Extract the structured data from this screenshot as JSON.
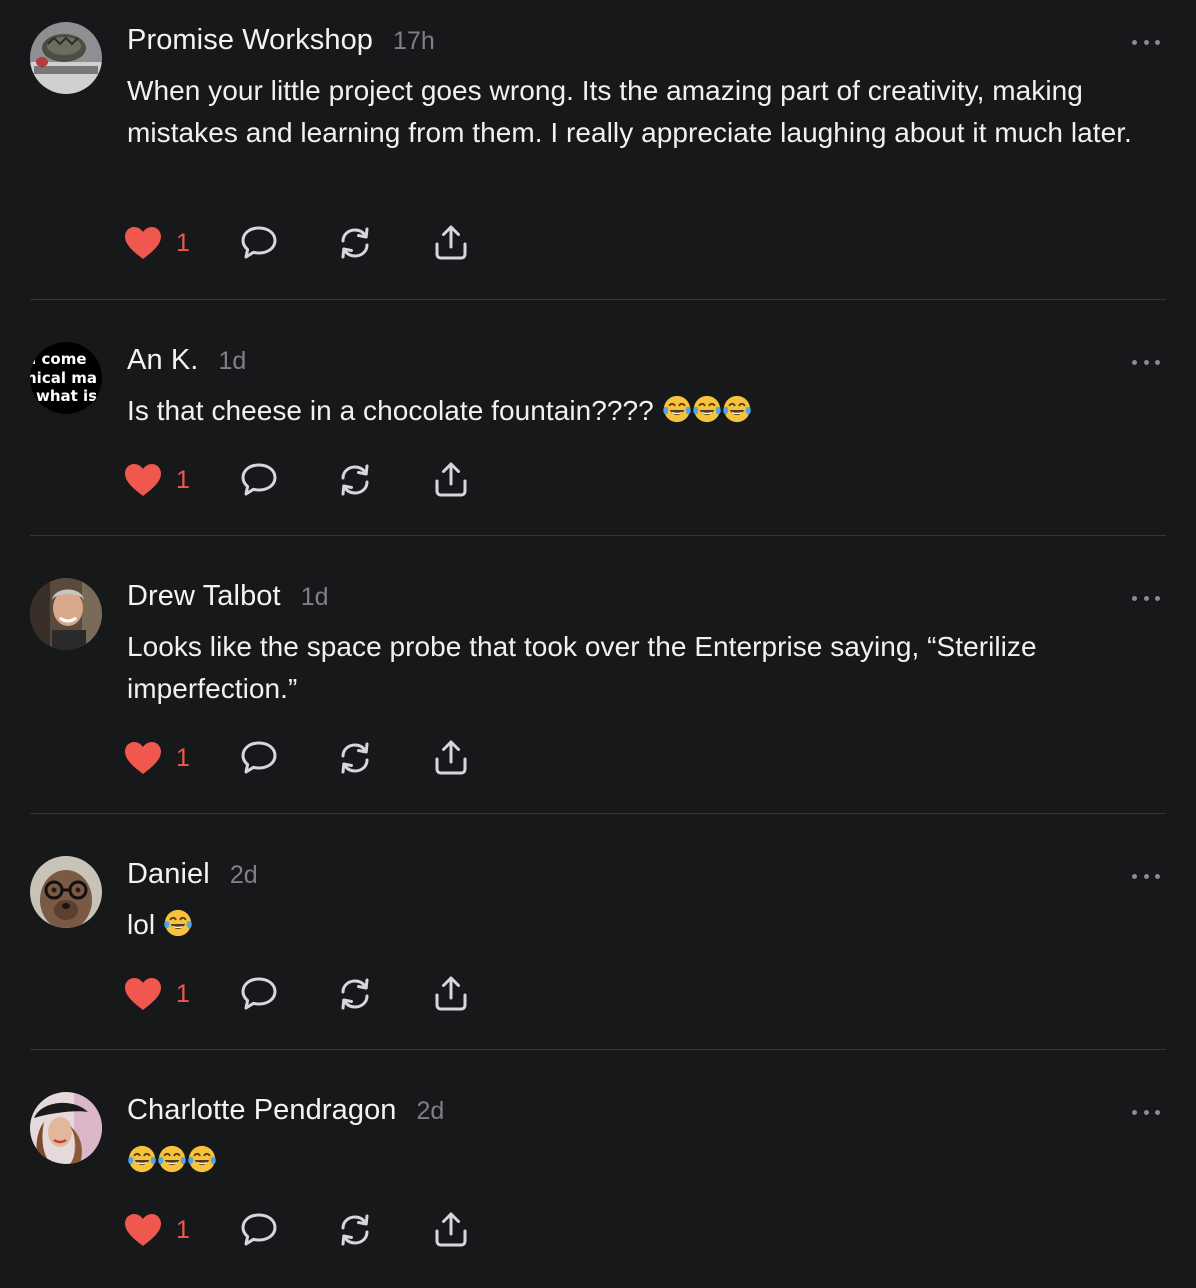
{
  "colors": {
    "background": "#17181a",
    "like": "#f0574f",
    "muted": "#7f8086",
    "divider": "#34353a"
  },
  "icons": {
    "like": "heart-icon",
    "reply": "speech-bubble-icon",
    "repost": "repost-arrows-icon",
    "share": "share-upload-icon",
    "more": "ellipsis-icon"
  },
  "comments": [
    {
      "author": "Promise Workshop",
      "time": "17h",
      "text": "When your little project goes wrong. Its the amazing part of creativity, making mistakes and learning from them. I really appreciate laughing about it much later.",
      "emoji_count": 0,
      "likes": "1"
    },
    {
      "author": "An K.",
      "time": "1d",
      "text": "Is that cheese in a chocolate fountain???? ",
      "emoji_count": 3,
      "likes": "1",
      "avatar_text": [
        "ll come",
        "hical ma",
        "what is"
      ]
    },
    {
      "author": "Drew Talbot",
      "time": "1d",
      "text": "Looks like the space probe that took over the Enterprise saying, “Sterilize imperfection.”",
      "emoji_count": 0,
      "likes": "1"
    },
    {
      "author": "Daniel",
      "time": "2d",
      "text": "lol ",
      "emoji_count": 1,
      "likes": "1"
    },
    {
      "author": "Charlotte Pendragon",
      "time": "2d",
      "text": "",
      "emoji_count": 3,
      "likes": "1"
    }
  ]
}
